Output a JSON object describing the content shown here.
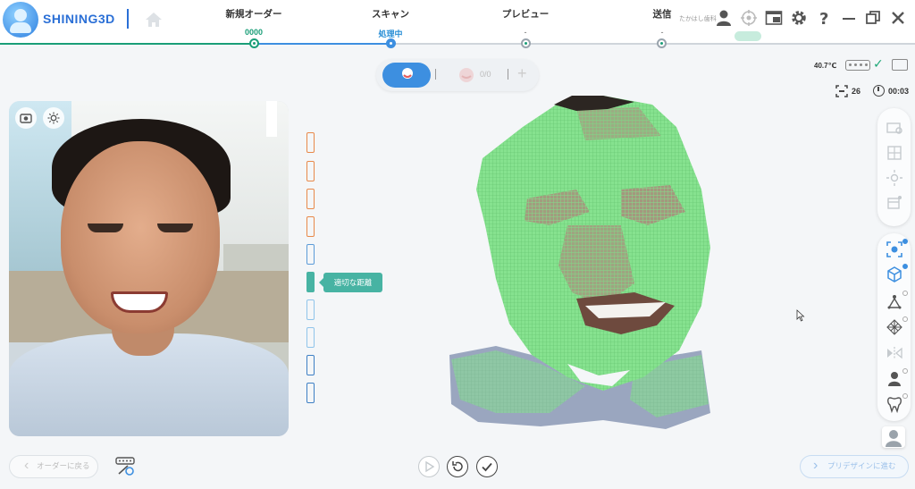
{
  "header": {
    "brand": "SHINING3D",
    "steps": [
      {
        "title": "新規オーダー",
        "sub": "0000"
      },
      {
        "title": "スキャン",
        "sub": "処理中"
      },
      {
        "title": "プレビュー",
        "sub": "-"
      },
      {
        "title": "送信",
        "sub": "-"
      }
    ],
    "right_label": "たかはし歯科"
  },
  "mode": {
    "count": "0/0"
  },
  "status": {
    "temperature": "40.7℃",
    "frames": "26",
    "timer": "00:03"
  },
  "distance": {
    "label": "適切な距離"
  },
  "bottom": {
    "back_label": "オーダーに戻る",
    "next_label": "プリデザインに進む"
  },
  "colors": {
    "accent": "#3d8fe0",
    "distance_ok": "#47b3a3",
    "distance_near": "#e8894a",
    "distance_far": "#5b9bd8",
    "scan_mesh": "#7ee08a"
  }
}
